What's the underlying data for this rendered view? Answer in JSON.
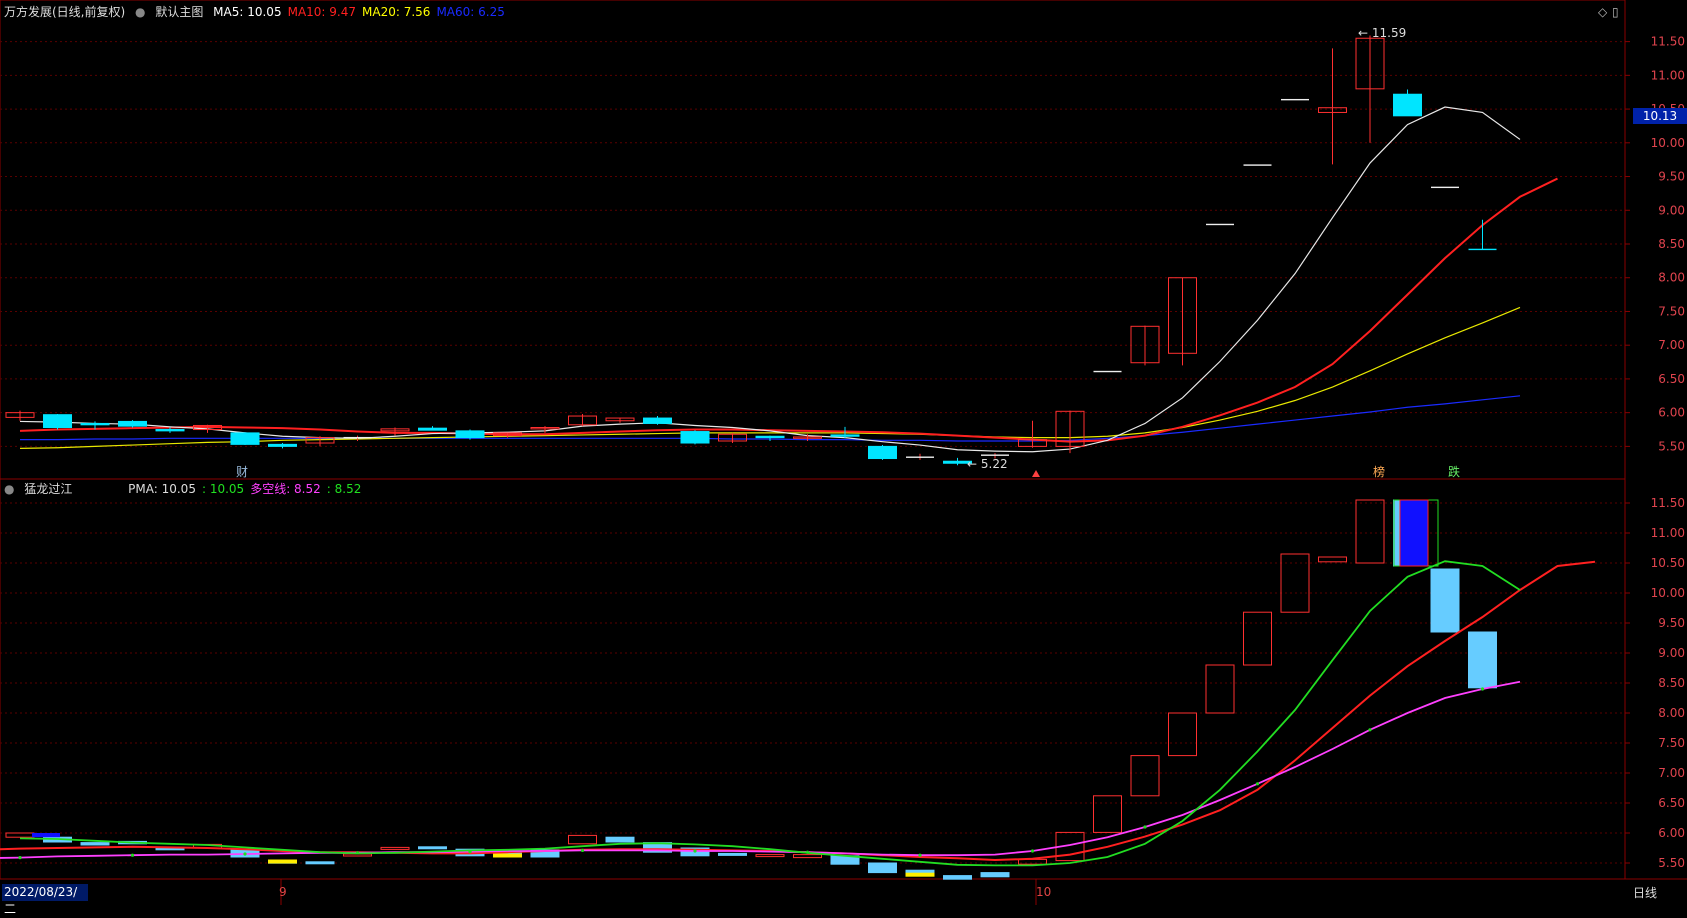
{
  "title": "万方发展(日线,前复权)",
  "main_label": "默认主图",
  "ma": [
    {
      "label": "MA5: 10.05",
      "color": "#ffffff"
    },
    {
      "label": "MA10: 9.47",
      "color": "#ff2020"
    },
    {
      "label": "MA20: 7.56",
      "color": "#ffff00"
    },
    {
      "label": "MA60: 6.25",
      "color": "#1a2bff"
    }
  ],
  "sub_title": "猛龙过江",
  "sub_labels": [
    {
      "label": "PMA: 10.05",
      "color": "#dddddd"
    },
    {
      "label": ": 10.05",
      "color": "#20e020"
    },
    {
      "label": "多空线: 8.52",
      "color": "#ff40ff"
    },
    {
      "label": ": 8.52",
      "color": "#20e020"
    }
  ],
  "current_price": "10.13",
  "date_label": "2022/08/23/二",
  "period_label": "日线",
  "month_labels": [
    "9",
    "10"
  ],
  "annotations": {
    "high": "11.59",
    "low": "5.22",
    "cai": "财",
    "bang": "榜",
    "die": "跌"
  },
  "colors": {
    "up": "#ff3030",
    "down": "#00e5ff",
    "grid": "#5a0000",
    "axis": "#8a0000",
    "text": "#e0444e"
  },
  "chart_data": [
    {
      "type": "candlestick",
      "title": "万方发展(日线,前复权)",
      "ylim": [
        5.15,
        11.85
      ],
      "yticks": [
        "5.50",
        "6.00",
        "6.50",
        "7.00",
        "7.50",
        "8.00",
        "8.50",
        "9.00",
        "9.50",
        "10.00",
        "10.50",
        "11.00",
        "11.50"
      ],
      "ohlc": [
        [
          5.93,
          6.03,
          5.88,
          6.0
        ],
        [
          5.97,
          5.98,
          5.75,
          5.78
        ],
        [
          5.84,
          5.87,
          5.75,
          5.82
        ],
        [
          5.87,
          5.89,
          5.78,
          5.8
        ],
        [
          5.75,
          5.78,
          5.7,
          5.73
        ],
        [
          5.75,
          5.82,
          5.7,
          5.81
        ],
        [
          5.7,
          5.71,
          5.52,
          5.53
        ],
        [
          5.53,
          5.55,
          5.47,
          5.5
        ],
        [
          5.55,
          5.65,
          5.5,
          5.63
        ],
        [
          5.64,
          5.66,
          5.58,
          5.64
        ],
        [
          5.73,
          5.78,
          5.66,
          5.76
        ],
        [
          5.77,
          5.8,
          5.74,
          5.74
        ],
        [
          5.73,
          5.75,
          5.6,
          5.63
        ],
        [
          5.66,
          5.7,
          5.63,
          5.7
        ],
        [
          5.76,
          5.8,
          5.7,
          5.78
        ],
        [
          5.82,
          5.98,
          5.8,
          5.95
        ],
        [
          5.88,
          5.92,
          5.85,
          5.92
        ],
        [
          5.92,
          5.95,
          5.82,
          5.84
        ],
        [
          5.72,
          5.74,
          5.53,
          5.55
        ],
        [
          5.58,
          5.7,
          5.55,
          5.68
        ],
        [
          5.65,
          5.66,
          5.58,
          5.63
        ],
        [
          5.62,
          5.68,
          5.58,
          5.64
        ],
        [
          5.67,
          5.79,
          5.62,
          5.65
        ],
        [
          5.5,
          5.52,
          5.3,
          5.32
        ],
        [
          5.34,
          5.39,
          5.3,
          5.35
        ],
        [
          5.28,
          5.33,
          5.22,
          5.25
        ],
        [
          5.38,
          5.4,
          5.32,
          5.38
        ],
        [
          5.5,
          5.88,
          5.48,
          5.6
        ],
        [
          5.5,
          6.03,
          5.4,
          6.02
        ],
        [
          6.62,
          6.62,
          6.62,
          6.62
        ],
        [
          6.74,
          7.29,
          6.7,
          7.28
        ],
        [
          6.88,
          8.0,
          6.7,
          8.0
        ],
        [
          8.8,
          8.8,
          8.8,
          8.8
        ],
        [
          9.68,
          9.68,
          9.68,
          9.68
        ],
        [
          10.65,
          10.65,
          10.65,
          10.65
        ],
        [
          10.45,
          11.4,
          9.68,
          10.52
        ],
        [
          10.8,
          11.59,
          10.0,
          11.55
        ],
        [
          10.72,
          10.79,
          10.4,
          10.4
        ],
        [
          9.35,
          9.35,
          9.35,
          9.35
        ],
        [
          8.43,
          8.86,
          8.42,
          8.42
        ]
      ],
      "ma5": [
        5.87,
        5.86,
        5.84,
        5.83,
        5.79,
        5.76,
        5.7,
        5.65,
        5.63,
        5.62,
        5.65,
        5.69,
        5.7,
        5.71,
        5.73,
        5.8,
        5.83,
        5.85,
        5.81,
        5.78,
        5.73,
        5.66,
        5.63,
        5.57,
        5.52,
        5.45,
        5.43,
        5.42,
        5.46,
        5.59,
        5.84,
        6.22,
        6.76,
        7.37,
        8.06,
        8.89,
        9.7,
        10.27,
        10.53,
        10.45,
        10.05
      ],
      "ma10": [
        5.73,
        5.75,
        5.76,
        5.77,
        5.78,
        5.79,
        5.78,
        5.77,
        5.75,
        5.72,
        5.7,
        5.7,
        5.69,
        5.68,
        5.68,
        5.7,
        5.72,
        5.74,
        5.75,
        5.75,
        5.74,
        5.73,
        5.72,
        5.71,
        5.69,
        5.66,
        5.63,
        5.6,
        5.57,
        5.59,
        5.66,
        5.79,
        5.96,
        6.15,
        6.38,
        6.72,
        7.21,
        7.75,
        8.29,
        8.78,
        9.2,
        9.47
      ],
      "ma20": [
        5.47,
        5.48,
        5.5,
        5.52,
        5.54,
        5.56,
        5.57,
        5.59,
        5.6,
        5.61,
        5.62,
        5.63,
        5.64,
        5.65,
        5.66,
        5.67,
        5.68,
        5.69,
        5.7,
        5.7,
        5.7,
        5.7,
        5.7,
        5.69,
        5.68,
        5.66,
        5.64,
        5.63,
        5.63,
        5.65,
        5.7,
        5.78,
        5.89,
        6.02,
        6.18,
        6.38,
        6.62,
        6.87,
        7.11,
        7.33,
        7.56
      ],
      "ma60": [
        5.6,
        5.6,
        5.61,
        5.61,
        5.62,
        5.62,
        5.62,
        5.62,
        5.62,
        5.62,
        5.62,
        5.62,
        5.62,
        5.62,
        5.62,
        5.62,
        5.62,
        5.62,
        5.62,
        5.61,
        5.61,
        5.6,
        5.6,
        5.59,
        5.59,
        5.58,
        5.58,
        5.58,
        5.59,
        5.62,
        5.66,
        5.71,
        5.77,
        5.83,
        5.89,
        5.95,
        6.01,
        6.08,
        6.13,
        6.19,
        6.25
      ]
    },
    {
      "type": "candlestick",
      "title": "猛龙过江",
      "ylim": [
        5.25,
        11.75
      ],
      "yticks": [
        "5.50",
        "6.00",
        "6.50",
        "7.00",
        "7.50",
        "8.00",
        "8.50",
        "9.00",
        "9.50",
        "10.00",
        "10.50",
        "11.00",
        "11.50"
      ],
      "boxes": [
        [
          5.93,
          6.0
        ],
        [
          5.93,
          5.85
        ],
        [
          5.84,
          5.8
        ],
        [
          5.86,
          5.82
        ],
        [
          5.76,
          5.72
        ],
        [
          5.75,
          5.81
        ],
        [
          5.72,
          5.6
        ],
        [
          5.53,
          5.5
        ],
        [
          5.52,
          5.5
        ],
        [
          5.64,
          5.65
        ],
        [
          5.74,
          5.76
        ],
        [
          5.77,
          5.74
        ],
        [
          5.73,
          5.62
        ],
        [
          5.68,
          5.64
        ],
        [
          5.72,
          5.6
        ],
        [
          5.82,
          5.96
        ],
        [
          5.93,
          5.85
        ],
        [
          5.84,
          5.68
        ],
        [
          5.75,
          5.62
        ],
        [
          5.66,
          5.63
        ],
        [
          5.61,
          5.64
        ],
        [
          5.59,
          5.64
        ],
        [
          5.62,
          5.48
        ],
        [
          5.5,
          5.34
        ],
        [
          5.38,
          5.34
        ],
        [
          5.29,
          5.23
        ],
        [
          5.34,
          5.27
        ],
        [
          5.48,
          5.56
        ],
        [
          5.54,
          6.01
        ],
        [
          6.01,
          6.62
        ],
        [
          6.62,
          7.29
        ],
        [
          7.29,
          8.0
        ],
        [
          8.0,
          8.8
        ],
        [
          8.8,
          9.68
        ],
        [
          9.68,
          10.65
        ],
        [
          10.52,
          10.6
        ],
        [
          10.5,
          11.55
        ],
        [
          11.55,
          10.45
        ],
        [
          10.4,
          9.35
        ],
        [
          9.35,
          8.42
        ]
      ],
      "pma": [
        5.91,
        5.9,
        5.87,
        5.84,
        5.82,
        5.8,
        5.76,
        5.72,
        5.68,
        5.66,
        5.67,
        5.69,
        5.71,
        5.72,
        5.74,
        5.78,
        5.82,
        5.83,
        5.81,
        5.78,
        5.73,
        5.67,
        5.62,
        5.57,
        5.52,
        5.47,
        5.46,
        5.46,
        5.5,
        5.6,
        5.82,
        6.2,
        6.72,
        7.36,
        8.05,
        8.88,
        9.7,
        10.27,
        10.53,
        10.45,
        10.05
      ],
      "ma10": [
        5.7,
        5.72,
        5.74,
        5.75,
        5.76,
        5.77,
        5.76,
        5.75,
        5.73,
        5.7,
        5.68,
        5.68,
        5.67,
        5.66,
        5.66,
        5.68,
        5.7,
        5.72,
        5.73,
        5.73,
        5.72,
        5.71,
        5.7,
        5.68,
        5.66,
        5.63,
        5.6,
        5.58,
        5.55,
        5.57,
        5.64,
        5.77,
        5.94,
        6.14,
        6.38,
        6.72,
        7.21,
        7.75,
        8.29,
        8.78,
        9.2,
        9.6,
        10.05,
        10.45,
        10.52
      ],
      "duokong": [
        5.55,
        5.57,
        5.58,
        5.59,
        5.61,
        5.62,
        5.63,
        5.64,
        5.64,
        5.65,
        5.66,
        5.67,
        5.67,
        5.68,
        5.68,
        5.69,
        5.7,
        5.7,
        5.71,
        5.71,
        5.71,
        5.7,
        5.7,
        5.69,
        5.68,
        5.66,
        5.64,
        5.63,
        5.63,
        5.64,
        5.7,
        5.8,
        5.93,
        6.1,
        6.3,
        6.55,
        6.82,
        7.1,
        7.4,
        7.72,
        8.0,
        8.25,
        8.4,
        8.52
      ]
    }
  ]
}
